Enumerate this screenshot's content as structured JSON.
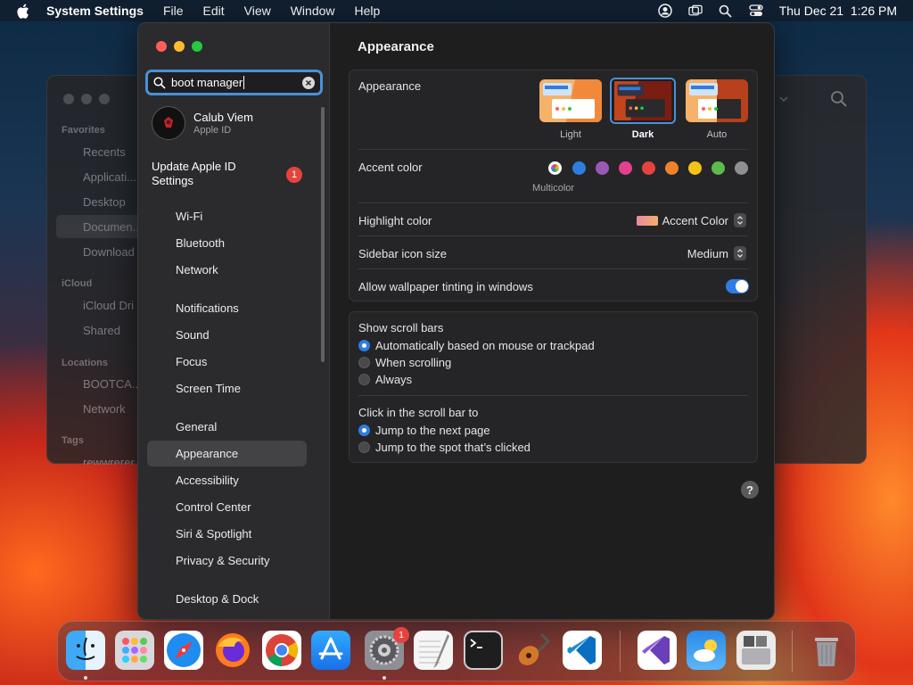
{
  "menubar": {
    "app_name": "System Settings",
    "menus": [
      "File",
      "Edit",
      "View",
      "Window",
      "Help"
    ],
    "clock": "Thu Dec 21  1:26 PM"
  },
  "finder": {
    "sections": [
      "Favorites",
      "iCloud",
      "Locations",
      "Tags"
    ],
    "favorites": [
      "Recents",
      "Applicati...",
      "Desktop",
      "Documen...",
      "Download"
    ],
    "icloud": [
      "iCloud Dri",
      "Shared"
    ],
    "locations": [
      "BOOTCA...",
      "Network"
    ],
    "tags": [
      "rewwrerer"
    ]
  },
  "sidebar": {
    "search": {
      "value": "boot manager"
    },
    "user": {
      "name": "Calub Viem",
      "subtitle": "Apple ID"
    },
    "update": {
      "label": "Update Apple ID Settings",
      "badge": "1"
    },
    "items": [
      "Wi-Fi",
      "Bluetooth",
      "Network",
      "Notifications",
      "Sound",
      "Focus",
      "Screen Time",
      "General",
      "Appearance",
      "Accessibility",
      "Control Center",
      "Siri & Spotlight",
      "Privacy & Security",
      "Desktop & Dock"
    ],
    "selected": "Appearance"
  },
  "content": {
    "title": "Appearance",
    "appearance": {
      "label": "Appearance",
      "options": [
        "Light",
        "Dark",
        "Auto"
      ],
      "selected": "Dark"
    },
    "accent": {
      "label": "Accent color",
      "colors": [
        "#a65fd0",
        "#2f7de0",
        "#9b59b6",
        "#e3418f",
        "#e5443e",
        "#f0822a",
        "#f4c317",
        "#5dbb4b",
        "#8e8e93"
      ],
      "multicolor_label": "Multicolor"
    },
    "highlight": {
      "label": "Highlight color",
      "value": "Accent Color"
    },
    "sidebar_icon": {
      "label": "Sidebar icon size",
      "value": "Medium"
    },
    "tinting": {
      "label": "Allow wallpaper tinting in windows",
      "on": true
    },
    "scrollbars": {
      "label": "Show scroll bars",
      "options": [
        "Automatically based on mouse or trackpad",
        "When scrolling",
        "Always"
      ],
      "selected": 0
    },
    "click_scroll": {
      "label": "Click in the scroll bar to",
      "options": [
        "Jump to the next page",
        "Jump to the spot that’s clicked"
      ],
      "selected": 0
    },
    "help": "?"
  },
  "dock": {
    "apps": [
      "finder-icon",
      "launchpad-icon",
      "safari-icon",
      "firefox-icon",
      "chrome-icon",
      "app-store-icon",
      "system-settings-icon",
      "textedit-icon",
      "terminal-icon",
      "garageband-icon",
      "vscode-icon",
      "visual-studio-icon",
      "weather-icon",
      "boot-camp-icon",
      "trash-icon"
    ],
    "settings_badge": "1"
  }
}
